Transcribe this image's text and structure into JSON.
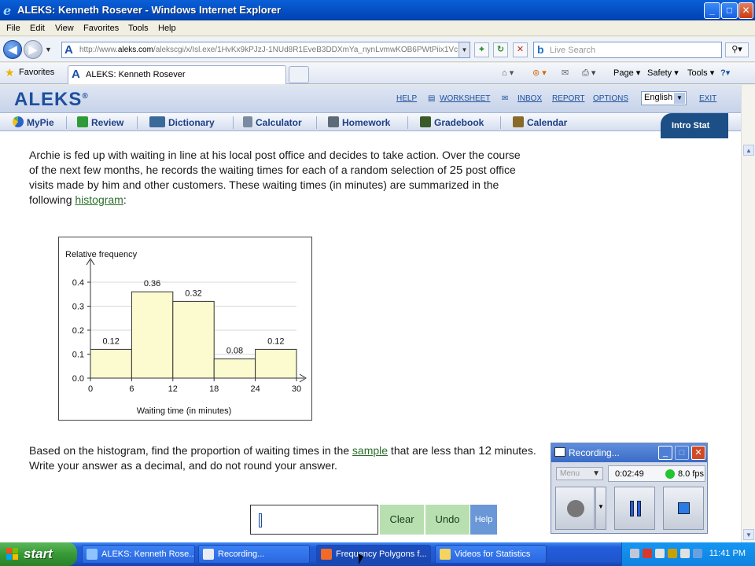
{
  "window": {
    "title": "ALEKS: Kenneth Rosever - Windows Internet Explorer",
    "minimize": "_",
    "maximize": "□",
    "close": "✕"
  },
  "menubar": [
    "File",
    "Edit",
    "View",
    "Favorites",
    "Tools",
    "Help"
  ],
  "address": {
    "url_prefix": "http://www.",
    "url_domain": "aleks.com",
    "url_rest": "/alekscgi/x/Isl.exe/1HvKx9kPJzJ-1NUd8R1EveB3DDXmYa_nynLvmwKOB6PWtPiix1Vc",
    "search_placeholder": "Live Search"
  },
  "favorites": {
    "label": "Favorites",
    "tab_title": "ALEKS: Kenneth Rosever",
    "commands": [
      "Page ▾",
      "Safety ▾",
      "Tools ▾",
      "?▾"
    ]
  },
  "aleks": {
    "logo": "ALEKS",
    "reg": "®",
    "links": [
      "HELP",
      "WORKSHEET",
      "INBOX",
      "REPORT",
      "OPTIONS",
      "EXIT"
    ],
    "language": "English",
    "nav": [
      "MyPie",
      "Review",
      "Dictionary",
      "Calculator",
      "Homework",
      "Gradebook",
      "Calendar"
    ],
    "course_tab": "Intro Stat"
  },
  "problem": {
    "text1": "Archie is fed up with waiting in line at his local post office and decides to take action. Over the course of the next few months, he records the waiting times for each of a random selection of ",
    "n": "25",
    "text2": " post office visits made by him and other customers. These waiting times (in minutes) are summarized in the following ",
    "link1": "histogram",
    "text3": ":",
    "q1": "Based on the histogram, find the proportion of waiting times in the ",
    "link2": "sample",
    "q2": " that are less than ",
    "threshold": "12",
    "q3": " minutes. Write your answer as a decimal, and do not round your answer."
  },
  "chart_data": {
    "type": "bar",
    "ylabel": "Relative frequency",
    "xlabel": "Waiting time (in minutes)",
    "bin_edges": [
      0,
      6,
      12,
      18,
      24,
      30
    ],
    "values": [
      0.12,
      0.36,
      0.32,
      0.08,
      0.12
    ],
    "value_labels": [
      "0.12",
      "0.36",
      "0.32",
      "0.08",
      "0.12"
    ],
    "yticks": [
      "0.0",
      "0.1",
      "0.2",
      "0.3",
      "0.4"
    ],
    "xticks": [
      "0",
      "6",
      "12",
      "18",
      "24",
      "30"
    ],
    "ylim": [
      0,
      0.4
    ],
    "xlim": [
      0,
      30
    ],
    "grid": true,
    "bar_color": "#fbfbcf"
  },
  "answer": {
    "clear": "Clear",
    "undo": "Undo",
    "help": "Help"
  },
  "recorder": {
    "title": "Recording...",
    "menu": "Menu",
    "time": "0:02:49",
    "fps": "8.0 fps"
  },
  "taskbar": {
    "start": "start",
    "tasks": [
      "ALEKS: Kenneth Rose...",
      "Recording...",
      "Frequency Polygons f...",
      "Videos for Statistics"
    ],
    "clock": "11:41 PM"
  }
}
